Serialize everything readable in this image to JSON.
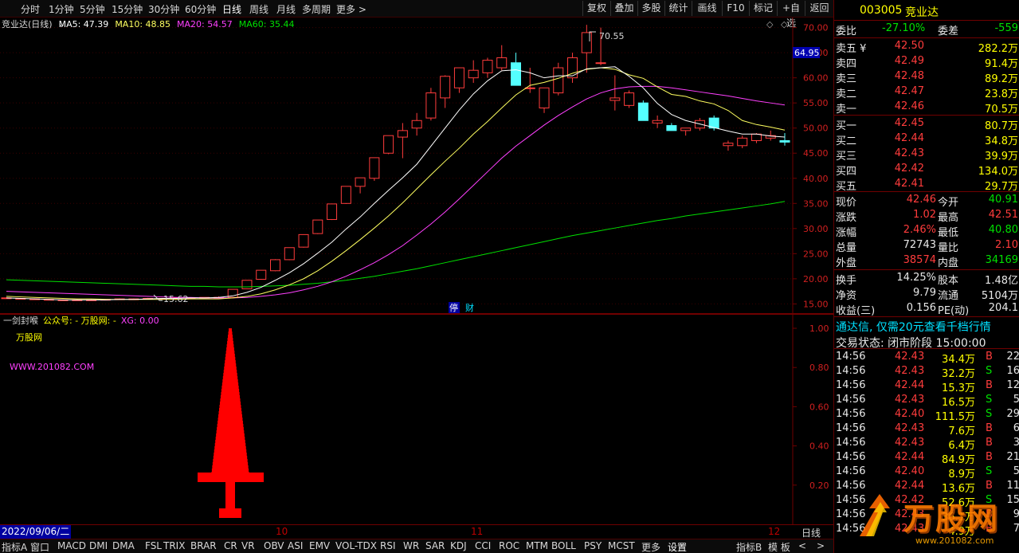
{
  "timeframes": [
    "分时",
    "1分钟",
    "5分钟",
    "15分钟",
    "30分钟",
    "60分钟",
    "日线",
    "周线",
    "月线",
    "多周期",
    "更多 >"
  ],
  "toolbar": [
    "复权",
    "叠加",
    "多股",
    "统计",
    "画线",
    "F10",
    "标记",
    "+自选",
    "返回"
  ],
  "main": {
    "title": "竞业达(日线)",
    "ma5": "MA5: 47.39",
    "ma10": "MA10: 48.85",
    "ma20": "MA20: 54.57",
    "ma60": "MA60: 35.44",
    "high_label": "70.55",
    "low_label": "15.62",
    "current_price_tag": "64.95",
    "markers": [
      "停",
      "财"
    ],
    "axis": [
      "70.00",
      "65.00",
      "60.00",
      "55.00",
      "50.00",
      "45.00",
      "40.00",
      "35.00",
      "30.00",
      "25.00",
      "20.00",
      "15.00"
    ]
  },
  "indicator": {
    "title": "一剑封喉",
    "public_label": "公众号: - 万股网: -",
    "xg": "XG: 0.00",
    "logo_text": "万股网",
    "url": "WWW.201082.COM",
    "axis": [
      "1.00",
      "0.80",
      "0.60",
      "0.40",
      "0.20"
    ]
  },
  "datebar": {
    "date": "2022/09/06/二",
    "ticks": [
      "10",
      "11",
      "12"
    ],
    "period": "日线"
  },
  "bottom_tabs": [
    "指标A",
    "窗口",
    "MACD",
    "DMI",
    "DMA",
    "FSL",
    "TRIX",
    "BRAR",
    "CR",
    "VR",
    "OBV",
    "ASI",
    "EMV",
    "VOL-TDX",
    "RSI",
    "WR",
    "SAR",
    "KDJ",
    "CCI",
    "ROC",
    "MTM",
    "BOLL",
    "PSY",
    "MCST",
    "更多",
    "设置",
    "指标B",
    "模 板",
    "<",
    ">"
  ],
  "stock": {
    "code": "003005",
    "name": "竞业达"
  },
  "quote": {
    "weibi_label": "委比",
    "weibi": "-27.10%",
    "weicha_label": "委差",
    "weicha": "-559",
    "asks": [
      {
        "label": "卖五 ¥",
        "price": "42.50",
        "vol": "282.2万"
      },
      {
        "label": "卖四",
        "price": "42.49",
        "vol": "91.4万"
      },
      {
        "label": "卖三",
        "price": "42.48",
        "vol": "89.2万"
      },
      {
        "label": "卖二",
        "price": "42.47",
        "vol": "23.8万"
      },
      {
        "label": "卖一",
        "price": "42.46",
        "vol": "70.5万"
      }
    ],
    "bids": [
      {
        "label": "买一",
        "price": "42.45",
        "vol": "80.7万"
      },
      {
        "label": "买二",
        "price": "42.44",
        "vol": "34.8万"
      },
      {
        "label": "买三",
        "price": "42.43",
        "vol": "39.9万"
      },
      {
        "label": "买四",
        "price": "42.42",
        "vol": "134.0万"
      },
      {
        "label": "买五",
        "price": "42.41",
        "vol": "29.7万"
      }
    ],
    "stats": [
      {
        "l1": "现价",
        "v1": "42.46",
        "l2": "今开",
        "v2": "40.91",
        "c1": "red",
        "c2": "grn"
      },
      {
        "l1": "涨跌",
        "v1": "1.02",
        "l2": "最高",
        "v2": "42.51",
        "c1": "red",
        "c2": "red"
      },
      {
        "l1": "涨幅",
        "v1": "2.46%",
        "l2": "最低",
        "v2": "40.80",
        "c1": "red",
        "c2": "grn"
      },
      {
        "l1": "总量",
        "v1": "72743",
        "l2": "量比",
        "v2": "2.10",
        "c1": "wht",
        "c2": "red"
      },
      {
        "l1": "外盘",
        "v1": "38574",
        "l2": "内盘",
        "v2": "34169",
        "c1": "red",
        "c2": "grn"
      }
    ],
    "fundamentals": [
      {
        "l1": "换手",
        "v1": "14.25%",
        "l2": "股本",
        "v2": "1.48亿"
      },
      {
        "l1": "净资",
        "v1": "9.79",
        "l2": "流通",
        "v2": "5104万"
      },
      {
        "l1": "收益(三)",
        "v1": "0.156",
        "l2": "PE(动)",
        "v2": "204.1"
      }
    ],
    "promo": "通达信, 仅需20元查看千档行情",
    "trade_status": "交易状态: 闭市阶段 15:00:00"
  },
  "ticks": [
    {
      "t": "14:56",
      "p": "42.43",
      "v": "34.4万",
      "s": "B",
      "n": "22"
    },
    {
      "t": "14:56",
      "p": "42.43",
      "v": "32.2万",
      "s": "S",
      "n": "16"
    },
    {
      "t": "14:56",
      "p": "42.44",
      "v": "15.3万",
      "s": "B",
      "n": "12"
    },
    {
      "t": "14:56",
      "p": "42.43",
      "v": "16.5万",
      "s": "S",
      "n": "5"
    },
    {
      "t": "14:56",
      "p": "42.40",
      "v": "111.5万",
      "s": "S",
      "n": "29"
    },
    {
      "t": "14:56",
      "p": "42.43",
      "v": "7.6万",
      "s": "B",
      "n": "6"
    },
    {
      "t": "14:56",
      "p": "42.43",
      "v": "6.4万",
      "s": "B",
      "n": "3"
    },
    {
      "t": "14:56",
      "p": "42.44",
      "v": "84.9万",
      "s": "B",
      "n": "21"
    },
    {
      "t": "14:56",
      "p": "42.40",
      "v": "8.9万",
      "s": "S",
      "n": "5"
    },
    {
      "t": "14:56",
      "p": "42.44",
      "v": "13.6万",
      "s": "B",
      "n": "11"
    },
    {
      "t": "14:56",
      "p": "42.42",
      "v": "52.6万",
      "s": "S",
      "n": "15"
    },
    {
      "t": "14:56",
      "p": "42.43",
      "v": "36.1万",
      "s": "B",
      "n": "9"
    },
    {
      "t": "14:56",
      "p": "42.43",
      "v": "4.9万",
      "s": "B",
      "n": "7"
    }
  ],
  "watermark": {
    "brand": "万股网",
    "site": "www.201082.com"
  },
  "chart_data": {
    "type": "candlestick",
    "ylim": [
      13,
      72
    ],
    "candles": [
      [
        16.2,
        16.3,
        16.1,
        16.2
      ],
      [
        16.1,
        16.2,
        16.0,
        16.1
      ],
      [
        16.0,
        16.1,
        15.9,
        16.0
      ],
      [
        15.9,
        16.0,
        15.8,
        15.9
      ],
      [
        15.8,
        15.9,
        15.62,
        15.8
      ],
      [
        15.8,
        15.9,
        15.7,
        15.8
      ],
      [
        15.8,
        15.9,
        15.7,
        15.8
      ],
      [
        15.9,
        16.0,
        15.8,
        15.9
      ],
      [
        16.0,
        16.1,
        15.9,
        16.0
      ],
      [
        16.0,
        16.1,
        15.9,
        16.0
      ],
      [
        16.1,
        16.2,
        16.0,
        16.1
      ],
      [
        16.1,
        16.2,
        16.0,
        16.1
      ],
      [
        16.2,
        16.3,
        16.1,
        16.2
      ],
      [
        16.2,
        16.3,
        16.1,
        16.2
      ],
      [
        16.2,
        16.3,
        16.1,
        16.3
      ],
      [
        16.3,
        16.5,
        16.2,
        16.3
      ],
      [
        16.3,
        17.9,
        16.3,
        17.9
      ],
      [
        18.0,
        19.7,
        18.0,
        19.7
      ],
      [
        19.9,
        21.7,
        19.8,
        21.7
      ],
      [
        21.6,
        23.9,
        21.5,
        23.8
      ],
      [
        23.8,
        26.2,
        23.7,
        26.2
      ],
      [
        26.3,
        28.8,
        26.2,
        28.8
      ],
      [
        29.0,
        31.7,
        28.9,
        31.7
      ],
      [
        31.8,
        34.9,
        31.7,
        34.9
      ],
      [
        35.0,
        38.4,
        34.9,
        38.4
      ],
      [
        38.4,
        40.1,
        37.0,
        40.1
      ],
      [
        40.0,
        44.1,
        39.5,
        44.1
      ],
      [
        45.0,
        48.5,
        44.8,
        48.5
      ],
      [
        48.2,
        51.0,
        44.0,
        49.5
      ],
      [
        50.0,
        53.0,
        48.5,
        51.5
      ],
      [
        52.0,
        58.0,
        51.5,
        57.0
      ],
      [
        56.0,
        60.5,
        54.0,
        60.3
      ],
      [
        58.0,
        62.0,
        57.0,
        62.0
      ],
      [
        60.0,
        63.5,
        59.0,
        61.5
      ],
      [
        61.0,
        64.0,
        60.0,
        63.5
      ],
      [
        62.0,
        66.5,
        61.5,
        64.0
      ],
      [
        63.0,
        65.0,
        58.5,
        58.5
      ],
      [
        58.0,
        62.0,
        57.0,
        58.0
      ],
      [
        54.0,
        58.0,
        53.0,
        58.0
      ],
      [
        57.0,
        63.0,
        56.5,
        62.0
      ],
      [
        60.0,
        65.0,
        59.0,
        64.0
      ],
      [
        65.0,
        70.55,
        61.0,
        69.0
      ],
      [
        63.0,
        70.0,
        62.5,
        63.0
      ],
      [
        55.5,
        60.5,
        53.5,
        56.0
      ],
      [
        54.5,
        57.5,
        54.0,
        57.0
      ],
      [
        55.0,
        55.5,
        51.5,
        51.5
      ],
      [
        51.0,
        52.5,
        50.0,
        51.5
      ],
      [
        50.5,
        51.0,
        49.5,
        49.5
      ],
      [
        49.5,
        50.0,
        48.5,
        50.0
      ],
      [
        50.0,
        52.0,
        49.5,
        51.5
      ],
      [
        52.0,
        52.5,
        49.5,
        50.0
      ],
      [
        46.5,
        47.5,
        45.5,
        47.0
      ],
      [
        46.5,
        48.5,
        46.0,
        48.0
      ],
      [
        47.5,
        49.0,
        47.0,
        48.8
      ],
      [
        48.0,
        49.5,
        47.5,
        48.5
      ],
      [
        47.5,
        49.0,
        46.5,
        47.2
      ]
    ],
    "ma5": [
      16.2,
      16.1,
      16.0,
      15.9,
      15.8,
      15.8,
      15.8,
      15.8,
      15.9,
      15.9,
      16.0,
      16.1,
      16.1,
      16.2,
      16.2,
      16.3,
      16.6,
      17.3,
      18.3,
      19.7,
      21.2,
      23.0,
      25.1,
      27.3,
      29.9,
      32.3,
      35.0,
      37.6,
      40.1,
      42.8,
      46.4,
      50.0,
      53.6,
      56.8,
      59.4,
      61.4,
      61.6,
      61.0,
      60.0,
      60.4,
      60.4,
      61.8,
      62.0,
      62.2,
      60.3,
      58.0,
      54.9,
      52.7,
      51.5,
      50.8,
      50.1,
      49.4,
      48.8,
      48.8,
      48.4,
      48.2
    ],
    "ma10": [
      16.5,
      16.4,
      16.3,
      16.2,
      16.1,
      16.0,
      16.0,
      15.9,
      15.9,
      15.9,
      15.9,
      15.9,
      15.9,
      16.0,
      16.0,
      16.0,
      16.2,
      16.5,
      17.0,
      17.8,
      18.8,
      20.0,
      21.6,
      23.5,
      25.6,
      27.8,
      30.1,
      32.5,
      35.1,
      37.9,
      40.7,
      43.4,
      46.0,
      48.8,
      51.3,
      54.0,
      56.6,
      58.5,
      59.1,
      59.9,
      60.9,
      61.7,
      62.0,
      61.7,
      60.6,
      59.9,
      58.2,
      56.7,
      56.3,
      55.4,
      54.8,
      53.5,
      51.5,
      50.7,
      50.2,
      49.6
    ],
    "ma20": [
      17.5,
      17.4,
      17.3,
      17.2,
      17.1,
      17.0,
      16.9,
      16.8,
      16.7,
      16.6,
      16.5,
      16.4,
      16.3,
      16.3,
      16.2,
      16.2,
      16.2,
      16.3,
      16.5,
      16.8,
      17.2,
      17.8,
      18.5,
      19.4,
      20.5,
      21.8,
      23.2,
      24.8,
      26.6,
      28.7,
      30.9,
      33.3,
      35.9,
      38.6,
      41.3,
      44.0,
      46.4,
      48.5,
      50.6,
      52.5,
      54.2,
      55.8,
      57.0,
      57.8,
      58.2,
      58.3,
      58.3,
      58.0,
      57.6,
      57.2,
      56.8,
      56.4,
      55.9,
      55.4,
      55.0,
      54.6
    ],
    "ma60": [
      19.8,
      19.7,
      19.6,
      19.5,
      19.4,
      19.3,
      19.2,
      19.1,
      19.0,
      18.9,
      18.8,
      18.7,
      18.6,
      18.5,
      18.5,
      18.4,
      18.4,
      18.4,
      18.5,
      18.6,
      18.7,
      18.9,
      19.1,
      19.4,
      19.7,
      20.1,
      20.5,
      21.0,
      21.5,
      22.0,
      22.6,
      23.2,
      23.8,
      24.4,
      25.0,
      25.6,
      26.2,
      26.8,
      27.4,
      28.0,
      28.6,
      29.1,
      29.6,
      30.1,
      30.6,
      31.1,
      31.6,
      32.0,
      32.5,
      32.9,
      33.3,
      33.7,
      34.1,
      34.5,
      34.9,
      35.4
    ],
    "indicator_x_index": 16
  },
  "colors": {
    "up": "#ff3c3c",
    "down": "#54ffff",
    "ma5": "#ffffff",
    "ma10": "#ffff60",
    "ma20": "#ff40ff",
    "ma60": "#00e000",
    "grid": "#700000"
  }
}
